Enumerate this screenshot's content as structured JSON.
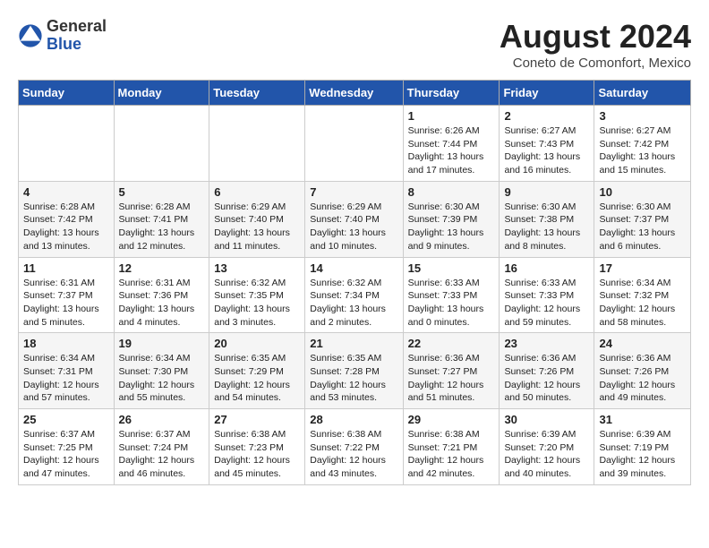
{
  "logo": {
    "general": "General",
    "blue": "Blue"
  },
  "title": {
    "month_year": "August 2024",
    "location": "Coneto de Comonfort, Mexico"
  },
  "weekdays": [
    "Sunday",
    "Monday",
    "Tuesday",
    "Wednesday",
    "Thursday",
    "Friday",
    "Saturday"
  ],
  "weeks": [
    [
      {
        "day": "",
        "content": ""
      },
      {
        "day": "",
        "content": ""
      },
      {
        "day": "",
        "content": ""
      },
      {
        "day": "",
        "content": ""
      },
      {
        "day": "1",
        "content": "Sunrise: 6:26 AM\nSunset: 7:44 PM\nDaylight: 13 hours\nand 17 minutes."
      },
      {
        "day": "2",
        "content": "Sunrise: 6:27 AM\nSunset: 7:43 PM\nDaylight: 13 hours\nand 16 minutes."
      },
      {
        "day": "3",
        "content": "Sunrise: 6:27 AM\nSunset: 7:42 PM\nDaylight: 13 hours\nand 15 minutes."
      }
    ],
    [
      {
        "day": "4",
        "content": "Sunrise: 6:28 AM\nSunset: 7:42 PM\nDaylight: 13 hours\nand 13 minutes."
      },
      {
        "day": "5",
        "content": "Sunrise: 6:28 AM\nSunset: 7:41 PM\nDaylight: 13 hours\nand 12 minutes."
      },
      {
        "day": "6",
        "content": "Sunrise: 6:29 AM\nSunset: 7:40 PM\nDaylight: 13 hours\nand 11 minutes."
      },
      {
        "day": "7",
        "content": "Sunrise: 6:29 AM\nSunset: 7:40 PM\nDaylight: 13 hours\nand 10 minutes."
      },
      {
        "day": "8",
        "content": "Sunrise: 6:30 AM\nSunset: 7:39 PM\nDaylight: 13 hours\nand 9 minutes."
      },
      {
        "day": "9",
        "content": "Sunrise: 6:30 AM\nSunset: 7:38 PM\nDaylight: 13 hours\nand 8 minutes."
      },
      {
        "day": "10",
        "content": "Sunrise: 6:30 AM\nSunset: 7:37 PM\nDaylight: 13 hours\nand 6 minutes."
      }
    ],
    [
      {
        "day": "11",
        "content": "Sunrise: 6:31 AM\nSunset: 7:37 PM\nDaylight: 13 hours\nand 5 minutes."
      },
      {
        "day": "12",
        "content": "Sunrise: 6:31 AM\nSunset: 7:36 PM\nDaylight: 13 hours\nand 4 minutes."
      },
      {
        "day": "13",
        "content": "Sunrise: 6:32 AM\nSunset: 7:35 PM\nDaylight: 13 hours\nand 3 minutes."
      },
      {
        "day": "14",
        "content": "Sunrise: 6:32 AM\nSunset: 7:34 PM\nDaylight: 13 hours\nand 2 minutes."
      },
      {
        "day": "15",
        "content": "Sunrise: 6:33 AM\nSunset: 7:33 PM\nDaylight: 13 hours\nand 0 minutes."
      },
      {
        "day": "16",
        "content": "Sunrise: 6:33 AM\nSunset: 7:33 PM\nDaylight: 12 hours\nand 59 minutes."
      },
      {
        "day": "17",
        "content": "Sunrise: 6:34 AM\nSunset: 7:32 PM\nDaylight: 12 hours\nand 58 minutes."
      }
    ],
    [
      {
        "day": "18",
        "content": "Sunrise: 6:34 AM\nSunset: 7:31 PM\nDaylight: 12 hours\nand 57 minutes."
      },
      {
        "day": "19",
        "content": "Sunrise: 6:34 AM\nSunset: 7:30 PM\nDaylight: 12 hours\nand 55 minutes."
      },
      {
        "day": "20",
        "content": "Sunrise: 6:35 AM\nSunset: 7:29 PM\nDaylight: 12 hours\nand 54 minutes."
      },
      {
        "day": "21",
        "content": "Sunrise: 6:35 AM\nSunset: 7:28 PM\nDaylight: 12 hours\nand 53 minutes."
      },
      {
        "day": "22",
        "content": "Sunrise: 6:36 AM\nSunset: 7:27 PM\nDaylight: 12 hours\nand 51 minutes."
      },
      {
        "day": "23",
        "content": "Sunrise: 6:36 AM\nSunset: 7:26 PM\nDaylight: 12 hours\nand 50 minutes."
      },
      {
        "day": "24",
        "content": "Sunrise: 6:36 AM\nSunset: 7:26 PM\nDaylight: 12 hours\nand 49 minutes."
      }
    ],
    [
      {
        "day": "25",
        "content": "Sunrise: 6:37 AM\nSunset: 7:25 PM\nDaylight: 12 hours\nand 47 minutes."
      },
      {
        "day": "26",
        "content": "Sunrise: 6:37 AM\nSunset: 7:24 PM\nDaylight: 12 hours\nand 46 minutes."
      },
      {
        "day": "27",
        "content": "Sunrise: 6:38 AM\nSunset: 7:23 PM\nDaylight: 12 hours\nand 45 minutes."
      },
      {
        "day": "28",
        "content": "Sunrise: 6:38 AM\nSunset: 7:22 PM\nDaylight: 12 hours\nand 43 minutes."
      },
      {
        "day": "29",
        "content": "Sunrise: 6:38 AM\nSunset: 7:21 PM\nDaylight: 12 hours\nand 42 minutes."
      },
      {
        "day": "30",
        "content": "Sunrise: 6:39 AM\nSunset: 7:20 PM\nDaylight: 12 hours\nand 40 minutes."
      },
      {
        "day": "31",
        "content": "Sunrise: 6:39 AM\nSunset: 7:19 PM\nDaylight: 12 hours\nand 39 minutes."
      }
    ]
  ]
}
